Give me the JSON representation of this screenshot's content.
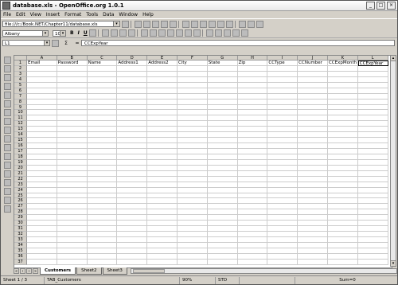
{
  "window": {
    "title": "database.xls - OpenOffice.org 1.0.1"
  },
  "menu": [
    "File",
    "Edit",
    "View",
    "Insert",
    "Format",
    "Tools",
    "Data",
    "Window",
    "Help"
  ],
  "toolbar": {
    "url": "file:///c:/Book.NET/Chapter11/database.xls"
  },
  "format_bar": {
    "font": "Albany",
    "size": "10",
    "bold": "B",
    "italic": "I",
    "underline": "U"
  },
  "formula_bar": {
    "cell_ref": "L1",
    "sum_symbol": "Σ",
    "equals": "=",
    "content": "CCExpYear"
  },
  "columns": [
    "A",
    "B",
    "C",
    "D",
    "E",
    "F",
    "G",
    "H",
    "I",
    "J",
    "K",
    "L"
  ],
  "header_row": [
    "Email",
    "Password",
    "Name",
    "Address1",
    "Address2",
    "City",
    "State",
    "Zip",
    "CCType",
    "CCNumber",
    "CCExpMonth",
    "CCExpYear"
  ],
  "row_count": 37,
  "sheet_tabs": [
    "Customers",
    "Sheet2",
    "Sheet3"
  ],
  "active_tab": "Customers",
  "status": {
    "sheet": "Sheet 1 / 3",
    "page_style": "TAB_Customers",
    "zoom": "90%",
    "mode": "STD",
    "sum": "Sum=0"
  }
}
